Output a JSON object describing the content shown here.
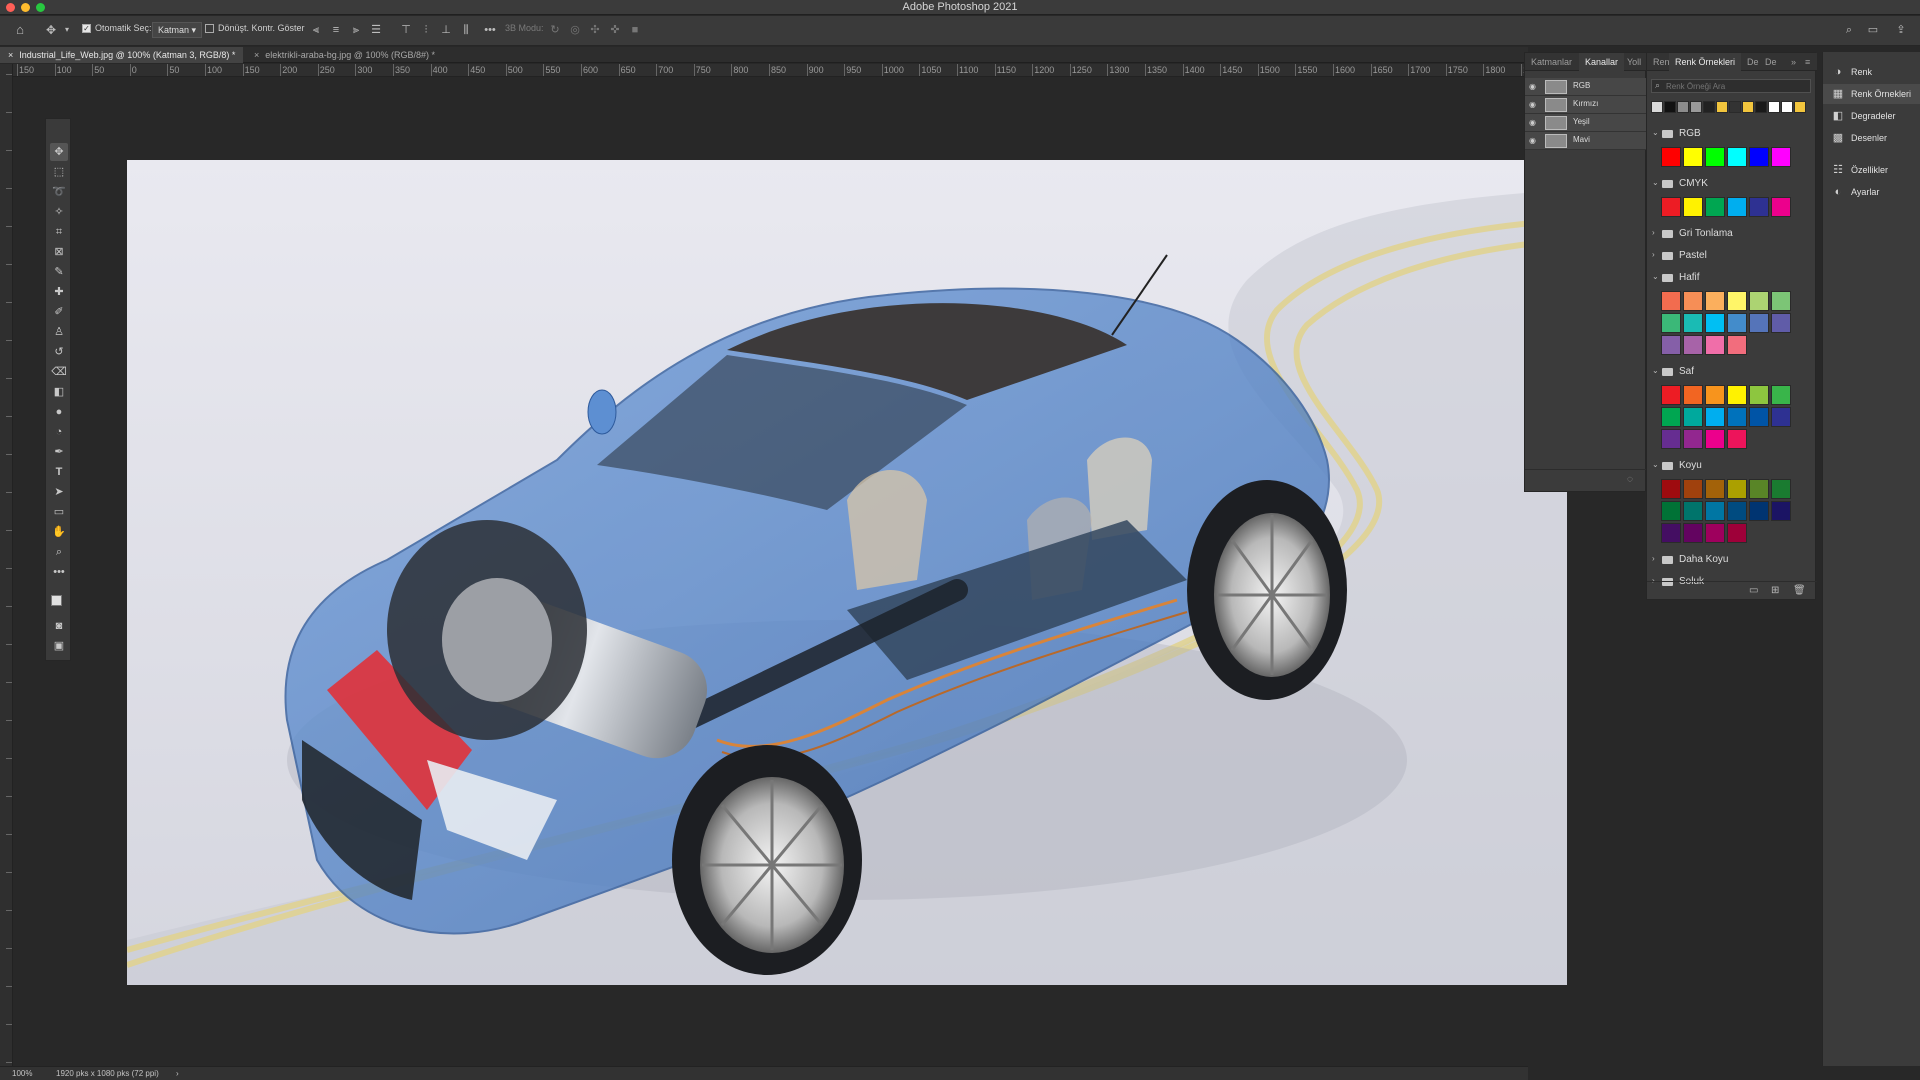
{
  "window": {
    "title": "Adobe Photoshop 2021"
  },
  "options_bar": {
    "auto_select_label": "Otomatik Seç:",
    "target_value": "Katman",
    "transform_label": "Dönüşt. Kontr. Göster",
    "mode_3d_label": "3B Modu:",
    "more_label": "•••"
  },
  "tabs": [
    {
      "label": "Industrial_Life_Web.jpg @ 100% (Katman 3, RGB/8) *",
      "active": true
    },
    {
      "label": "elektrikli-araba-bg.jpg @ 100% (RGB/8#) *",
      "active": false
    }
  ],
  "ruler": {
    "top_labels": [
      "150",
      "100",
      "50",
      "0",
      "50",
      "100",
      "150",
      "200",
      "250",
      "300",
      "350",
      "400",
      "450",
      "500",
      "550",
      "600",
      "650",
      "700",
      "750",
      "800",
      "850",
      "900",
      "950",
      "1000",
      "1050",
      "1100",
      "1150",
      "1200",
      "1250",
      "1300",
      "1350",
      "1400",
      "1450",
      "1500",
      "1550",
      "1600",
      "1650",
      "1700",
      "1750",
      "1800",
      "18"
    ]
  },
  "toolbox": {
    "tools": [
      "move-tool",
      "marquee-tool",
      "lasso-tool",
      "magic-wand-tool",
      "crop-tool",
      "frame-tool",
      "eyedropper-tool",
      "healing-tool",
      "brush-tool",
      "stamp-tool",
      "history-brush-tool",
      "eraser-tool",
      "gradient-tool",
      "blur-tool",
      "dodge-tool",
      "pen-tool",
      "type-tool",
      "path-selection-tool",
      "rectangle-tool",
      "hand-tool",
      "zoom-tool",
      "more-tools"
    ],
    "type_glyph": "T",
    "more_glyph": "•••"
  },
  "channels_panel": {
    "tabs": [
      "Katmanlar",
      "Kanallar",
      "Yoll",
      "Ren"
    ],
    "active_tab": "Kanallar",
    "channels": [
      "RGB",
      "Kırmızı",
      "Yeşil",
      "Mavi"
    ]
  },
  "swatches_panel": {
    "tabs": [
      "Renk Örnekleri",
      "De",
      "De"
    ],
    "search_placeholder": "Renk Örneği Ara",
    "recent": [
      "#d9d9d9",
      "#111111",
      "#8c8c8c",
      "#9a9a9a",
      "#222222",
      "#f2c53d",
      "#333333",
      "#f2c53d",
      "#1a1a1a",
      "#ffffff",
      "#ffffff",
      "#f2c53d"
    ],
    "groups": [
      {
        "name": "RGB",
        "expanded": true,
        "swatches": [
          "#ff0000",
          "#ffff00",
          "#00ff00",
          "#00ffff",
          "#0000ff",
          "#ff00ff"
        ]
      },
      {
        "name": "CMYK",
        "expanded": true,
        "swatches": [
          "#ed1c24",
          "#fff200",
          "#00a651",
          "#00aeef",
          "#2e3192",
          "#ec008c"
        ]
      },
      {
        "name": "Gri Tonlama",
        "expanded": false,
        "swatches": []
      },
      {
        "name": "Pastel",
        "expanded": false,
        "swatches": []
      },
      {
        "name": "Hafif",
        "expanded": true,
        "swatches": [
          "#f26c4f",
          "#f68e56",
          "#fbaf5d",
          "#fff568",
          "#acd372",
          "#7cc576",
          "#3bb878",
          "#1abbb4",
          "#00bff3",
          "#438ccb",
          "#5574b9",
          "#605ca8",
          "#855fa8",
          "#a763a8",
          "#f06ea9",
          "#f26d7d"
        ]
      },
      {
        "name": "Saf",
        "expanded": true,
        "swatches": [
          "#ed1c24",
          "#f26522",
          "#f7941d",
          "#fff200",
          "#8dc63f",
          "#39b54a",
          "#00a651",
          "#00a99d",
          "#00aeef",
          "#0072bc",
          "#0054a6",
          "#2e3192",
          "#662d91",
          "#92278f",
          "#ec008c",
          "#ed145b"
        ]
      },
      {
        "name": "Koyu",
        "expanded": true,
        "swatches": [
          "#9e0b0f",
          "#a0410d",
          "#a36209",
          "#aba000",
          "#598527",
          "#1a7b30",
          "#007236",
          "#00746b",
          "#0076a3",
          "#004b80",
          "#003471",
          "#1b1464",
          "#440e62",
          "#630460",
          "#9e005d",
          "#9e0039"
        ]
      },
      {
        "name": "Daha Koyu",
        "expanded": false,
        "swatches": []
      },
      {
        "name": "Soluk",
        "expanded": false,
        "swatches": []
      }
    ]
  },
  "right_panel": {
    "items": [
      "Renk",
      "Renk Örnekleri",
      "Degradeler",
      "Desenler",
      "Özellikler",
      "Ayarlar"
    ],
    "active": "Renk Örnekleri"
  },
  "status_bar": {
    "zoom": "100%",
    "doc_info": "1920 pks x 1080 pks (72 ppi)",
    "arrow": "›"
  },
  "colors": {
    "accent_blue": "#4f86c6",
    "road_yellow": "#e3d48a"
  }
}
